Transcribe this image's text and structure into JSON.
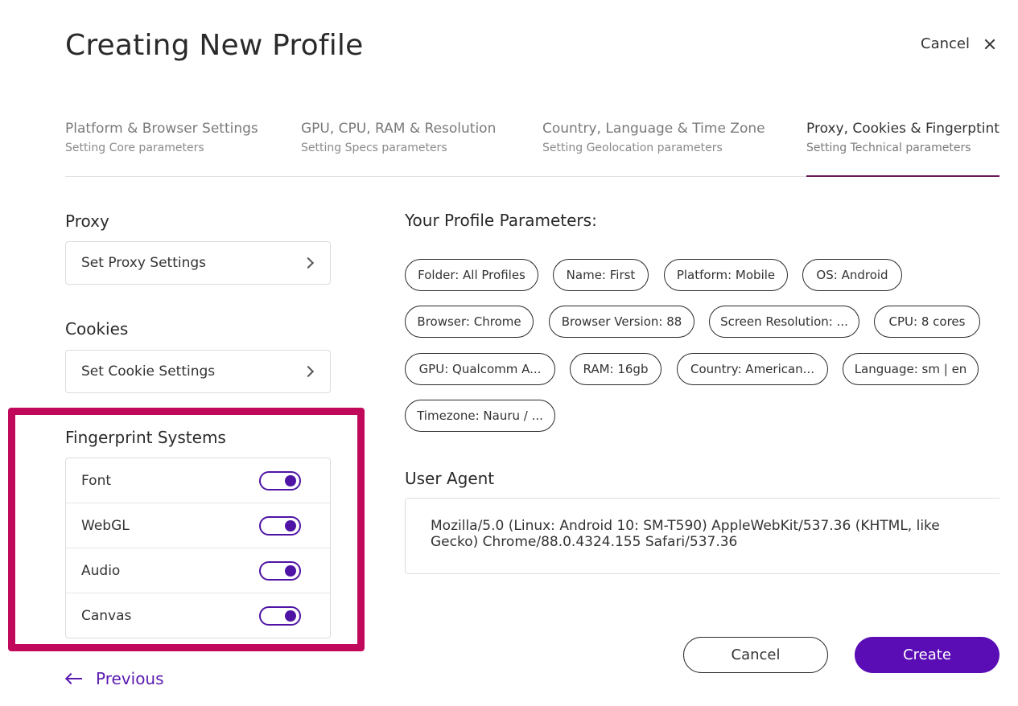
{
  "header": {
    "title": "Creating New Profile",
    "cancel_label": "Cancel"
  },
  "tabs": [
    {
      "title": "Platform & Browser Settings",
      "subtitle": "Setting Core parameters",
      "active": false
    },
    {
      "title": "GPU, CPU, RAM & Resolution",
      "subtitle": "Setting Specs parameters",
      "active": false
    },
    {
      "title": "Country, Language & Time Zone",
      "subtitle": "Setting Geolocation parameters",
      "active": false
    },
    {
      "title": "Proxy, Cookies & Fingerptint",
      "subtitle": "Setting Technical parameters",
      "active": true
    }
  ],
  "proxy": {
    "title": "Proxy",
    "button_label": "Set Proxy Settings"
  },
  "cookies": {
    "title": "Cookies",
    "button_label": "Set Cookie Settings"
  },
  "fingerprint": {
    "title": "Fingerprint Systems",
    "items": [
      {
        "label": "Font",
        "enabled": true
      },
      {
        "label": "WebGL",
        "enabled": true
      },
      {
        "label": "Audio",
        "enabled": true
      },
      {
        "label": "Canvas",
        "enabled": true
      }
    ]
  },
  "params": {
    "title": "Your Profile Parameters:",
    "chips": [
      "Folder: All Profiles",
      "Name: First",
      "Platform: Mobile",
      "OS: Android",
      "Browser: Chrome",
      "Browser Version: 88",
      "Screen Resolution: ...",
      "CPU: 8 cores",
      "GPU: Qualcomm A...",
      "RAM: 16gb",
      "Country: American...",
      "Language: sm | en",
      "Timezone: Nauru / ..."
    ]
  },
  "user_agent": {
    "title": "User Agent",
    "value": "Mozilla/5.0 (Linux: Android 10: SM-T590) AppleWebKit/537.36 (KHTML, like Gecko) Chrome/88.0.4324.155 Safari/537.36"
  },
  "footer": {
    "previous_label": "Previous",
    "cancel_label": "Cancel",
    "create_label": "Create"
  },
  "colors": {
    "accent": "#5a0db5",
    "highlight": "#c0095a",
    "active_tab_underline": "#6a1a5a"
  }
}
